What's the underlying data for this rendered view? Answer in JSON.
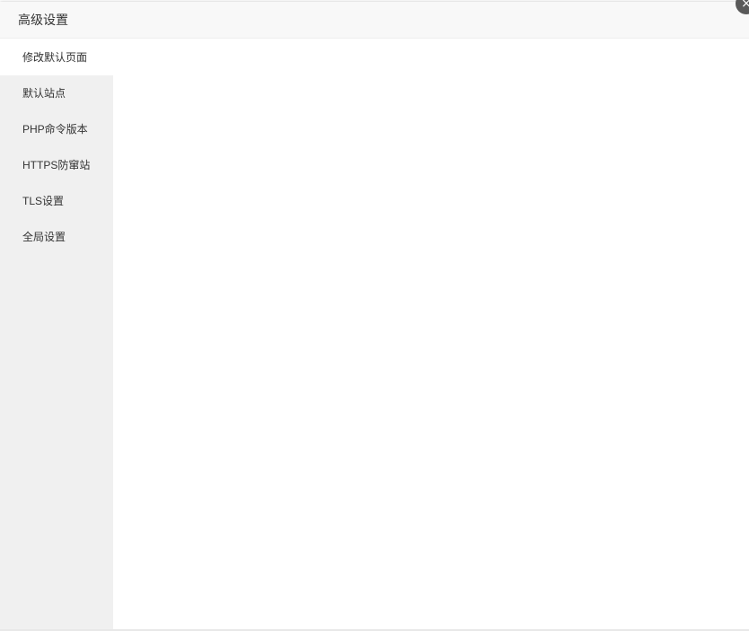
{
  "modal": {
    "title": "高级设置",
    "close_icon": "×"
  },
  "sidebar": {
    "items": [
      {
        "label": "修改默认页面",
        "active": true
      },
      {
        "label": "默认站点",
        "active": false
      },
      {
        "label": "PHP命令版本",
        "active": false
      },
      {
        "label": "HTTPS防窜站",
        "active": false
      },
      {
        "label": "TLS设置",
        "active": false
      },
      {
        "label": "全局设置",
        "active": false
      }
    ]
  },
  "colors": {
    "header_bg": "#f8f8f8",
    "sidebar_bg": "#f0f0f0",
    "active_item_bg": "#ffffff",
    "close_button_bg": "#595959",
    "text": "#333333"
  }
}
